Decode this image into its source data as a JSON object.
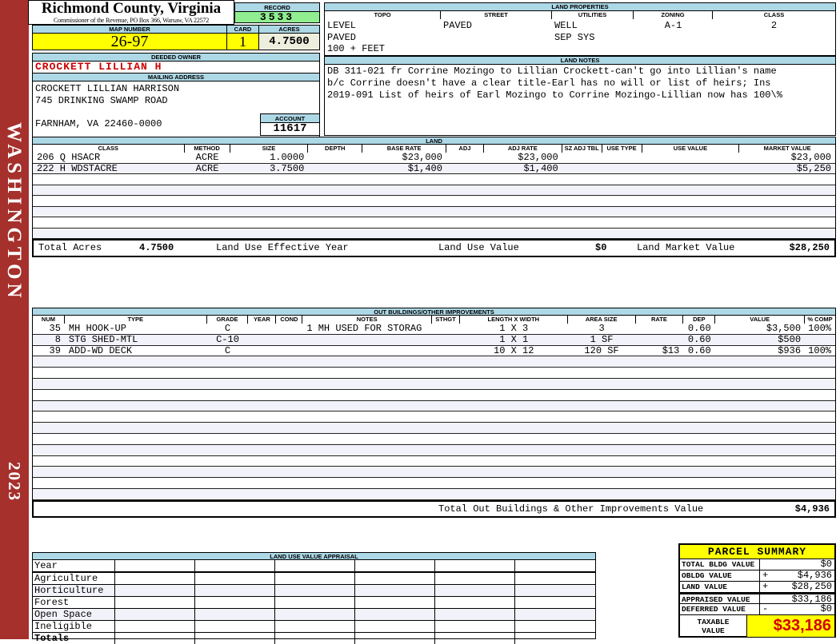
{
  "header": {
    "county": "Richmond County, Virginia",
    "subtitle": "Commissioner of the Revenue, PO Box 366, Warsaw, VA 22572",
    "record_label": "RECORD",
    "record_value": "3533",
    "map_number_label": "MAP NUMBER",
    "map_number": "26-97",
    "card_label": "CARD",
    "card": "1",
    "acres_label": "ACRES",
    "acres": "4.7500"
  },
  "sidebar": {
    "state": "WASHINGTON",
    "year": "2023"
  },
  "owner": {
    "deeded_owner_label": "DEEDED OWNER",
    "deeded_owner": "CROCKETT LILLIAN H",
    "mailing_address_label": "MAILING ADDRESS",
    "mailing_lines": [
      "CROCKETT LILLIAN HARRISON",
      "745 DRINKING SWAMP ROAD",
      "",
      "FARNHAM, VA 22460-0000"
    ],
    "account_label": "ACCOUNT",
    "account": "11617"
  },
  "land_properties": {
    "title": "LAND PROPERTIES",
    "columns": [
      {
        "label": "TOPO",
        "lines": [
          "LEVEL",
          "PAVED",
          "100 + FEET"
        ],
        "align": "al"
      },
      {
        "label": "STREET",
        "lines": [
          "PAVED"
        ],
        "align": "al"
      },
      {
        "label": "UTILITIES",
        "lines": [
          "WELL",
          "SEP SYS"
        ],
        "align": "al"
      },
      {
        "label": "ZONING",
        "lines": [
          "A-1"
        ],
        "align": "ac"
      },
      {
        "label": "CLASS",
        "lines": [
          "2"
        ],
        "align": "ac"
      }
    ]
  },
  "land_notes": {
    "title": "LAND NOTES",
    "lines": [
      "DB 311-021 fr Corrine Mozingo to Lillian Crockett-can't go into Lillian's name",
      "b/c Corrine doesn't have a clear title-Earl has no will or list of heirs; Ins",
      "2019-091 List of heirs of Earl Mozingo to Corrine Mozingo-Lillian now has 100\\%"
    ]
  },
  "land": {
    "title": "LAND",
    "columns": [
      "CLASS",
      "METHOD",
      "SIZE",
      "DEPTH",
      "BASE RATE",
      "ADJ",
      "ADJ RATE",
      "SZ ADJ TBL",
      "USE TYPE",
      "USE VALUE",
      "MARKET VALUE"
    ],
    "rows": [
      {
        "class": "206 Q HSACR",
        "method": "ACRE",
        "size": "1.0000",
        "depth": "",
        "base_rate": "$23,000",
        "adj": "",
        "adj_rate": "$23,000",
        "sz_adj_tbl": "",
        "use_type": "",
        "use_value": "",
        "market_value": "$23,000"
      },
      {
        "class": "222 H WDSTACRE",
        "method": "ACRE",
        "size": "3.7500",
        "depth": "",
        "base_rate": "$1,400",
        "adj": "",
        "adj_rate": "$1,400",
        "sz_adj_tbl": "",
        "use_type": "",
        "use_value": "",
        "market_value": "$5,250"
      }
    ],
    "empty_rows": 6,
    "totals": {
      "total_acres_label": "Total Acres",
      "total_acres": "4.7500",
      "effective_year_label": "Land Use Effective Year",
      "use_value_label": "Land Use Value",
      "use_value": "$0",
      "market_value_label": "Land Market Value",
      "market_value": "$28,250"
    }
  },
  "out_buildings": {
    "title": "OUT BUILDINGS/OTHER IMPROVEMENTS",
    "columns": [
      "NUM",
      "TYPE",
      "GRADE",
      "YEAR",
      "COND",
      "NOTES",
      "STHGT",
      "LENGTH X WIDTH",
      "AREA SIZE",
      "RATE",
      "DEP",
      "VALUE",
      "% COMP"
    ],
    "rows": [
      {
        "num": "35",
        "type": "MH HOOK-UP",
        "grade": "C",
        "year": "",
        "cond": "",
        "notes": "1 MH USED FOR STORAG",
        "sthgt": "",
        "lxw": "1 X 3",
        "area": "3",
        "rate": "",
        "dep": "0.60",
        "value": "$3,500",
        "comp": "100%"
      },
      {
        "num": "8",
        "type": "STG SHED-MTL",
        "grade": "C-10",
        "year": "",
        "cond": "",
        "notes": "",
        "sthgt": "",
        "lxw": "1 X 1",
        "area": "1 SF",
        "rate": "",
        "dep": "0.60",
        "value": "$500",
        "comp": ""
      },
      {
        "num": "39",
        "type": "ADD-WD DECK",
        "grade": "C",
        "year": "",
        "cond": "",
        "notes": "",
        "sthgt": "",
        "lxw": "10 X 12",
        "area": "120 SF",
        "rate": "$13",
        "dep": "0.60",
        "value": "$936",
        "comp": "100%"
      }
    ],
    "empty_rows": 13,
    "total_label": "Total Out Buildings & Other Improvements Value",
    "total_value": "$4,936"
  },
  "land_use_appraisal": {
    "title": "LAND USE VALUE APPRAISAL",
    "row_labels": [
      "Year",
      "Agriculture",
      "Horticulture",
      "Forest",
      "Open Space",
      "Ineligible",
      "Totals"
    ],
    "data_columns": 6
  },
  "parcel_summary": {
    "title": "PARCEL SUMMARY",
    "rows": [
      {
        "label": "TOTAL BLDG VALUE",
        "op": "",
        "value": "$0"
      },
      {
        "label": "OBLDG VALUE",
        "op": "+",
        "value": "$4,936"
      },
      {
        "label": "LAND VALUE",
        "op": "+",
        "value": "$28,250"
      },
      {
        "label": "APPRAISED VALUE",
        "op": "",
        "value": "$33,186"
      },
      {
        "label": "DEFERRED VALUE",
        "op": "-",
        "value": "$0"
      }
    ],
    "taxable_label": [
      "TAXABLE",
      "VALUE"
    ],
    "taxable_value": "$33,186"
  },
  "colors": {
    "sidebar_red": "#A5302C",
    "header_blue": "#ADD8E6",
    "record_green": "#90EE90",
    "field_yellow": "#FFFF00",
    "acres_cream": "#EEEEDF",
    "alt_row": "#F2F2FA",
    "owner_red": "#CC0000",
    "taxable_red": "#D40000"
  }
}
